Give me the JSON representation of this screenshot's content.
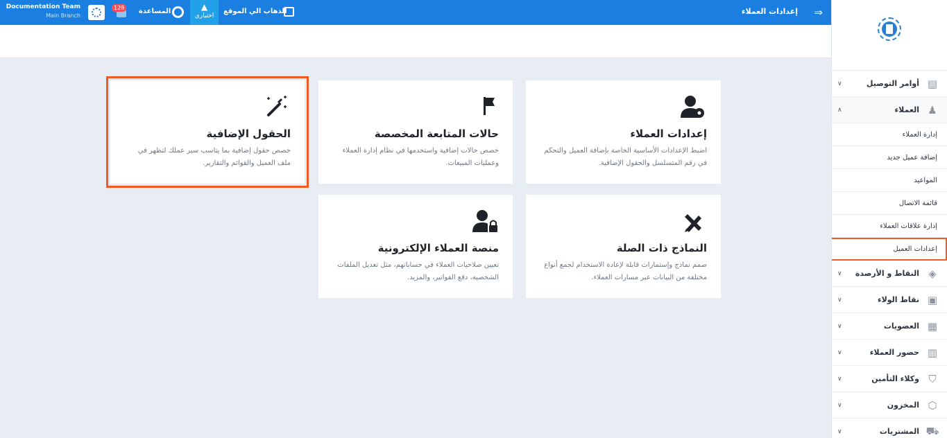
{
  "topbar": {
    "page_title": "إعدادات العملاء",
    "visit_site": "الذهاب الي الموقع",
    "shortcuts": "اختياري",
    "help": "المساعدة",
    "notifications_count": "128",
    "team_name": "Documentation Team",
    "branch_name": "Main Branch"
  },
  "sidebar": {
    "items": [
      {
        "label": "أوامر التوصيل"
      },
      {
        "label": "العملاء"
      },
      {
        "label": "النقاط و الأرصدة"
      },
      {
        "label": "نقاط الولاء"
      },
      {
        "label": "العضويات"
      },
      {
        "label": "حضور العملاء"
      },
      {
        "label": "وكلاء التأمين"
      },
      {
        "label": "المخزون"
      },
      {
        "label": "المشتريات"
      }
    ],
    "customers_sub": [
      {
        "label": "إدارة العملاء"
      },
      {
        "label": "إضافة عميل جديد"
      },
      {
        "label": "المواعيد"
      },
      {
        "label": "قائمة الاتصال"
      },
      {
        "label": "إدارة علاقات العملاء"
      },
      {
        "label": "إعدادات العميل"
      }
    ]
  },
  "cards": [
    {
      "title": "إعدادات العملاء",
      "desc": "اضبط الإعدادات الأساسية الخاصة بإضافة العميل والتحكم في رقم المتسلسل والحقول الإضافية.",
      "icon": "user-gear-icon"
    },
    {
      "title": "حالات المتابعة المخصصة",
      "desc": "خصص حالات إضافية واستخدمها في نظام إدارة العملاء وعمليات المبيعات.",
      "icon": "flag-icon"
    },
    {
      "title": "الحقول الإضافية",
      "desc": "خصص حقول إضافية بما يتاسب سير عملك لتظهر في ملف العميل والقوائم والتقارير.",
      "icon": "magic-wand-icon"
    },
    {
      "title": "النماذج ذات الصلة",
      "desc": "صمم نماذج وإستمارات قابلة لإعادة الاستخدام لجمع أنواع مختلفة من البيانات عبر مسارات العملاء.",
      "icon": "pencil-ruler-icon"
    },
    {
      "title": "منصة العملاء الإلكترونية",
      "desc": "تعيين صلاحيات العملاء في حساباتهم، مثل تعديل الملفات الشخصية، دفع الفواتير، والمزيد.",
      "icon": "user-lock-icon"
    }
  ],
  "colors": {
    "primary": "#1a7fe0",
    "highlight": "#f15a22",
    "background": "#e8edf3"
  }
}
